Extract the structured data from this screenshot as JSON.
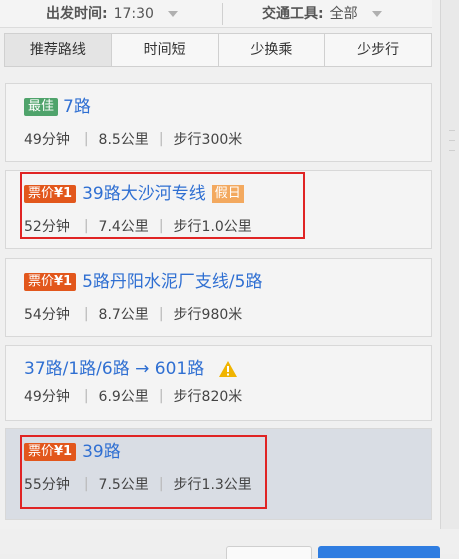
{
  "filters": {
    "departure_label": "出发时间:",
    "departure_value": "17:30",
    "transport_label": "交通工具:",
    "transport_value": "全部"
  },
  "tabs": [
    {
      "label": "推荐路线",
      "active": true
    },
    {
      "label": "时间短",
      "active": false
    },
    {
      "label": "少换乘",
      "active": false
    },
    {
      "label": "少步行",
      "active": false
    }
  ],
  "routes": [
    {
      "badge": "最佳",
      "name": "7路",
      "time": "49分钟",
      "distance": "8.5公里",
      "walk": "步行300米"
    },
    {
      "price_label": "票价",
      "price_value": "¥1",
      "name": "39路大沙河专线",
      "tag": "假日",
      "time": "52分钟",
      "distance": "7.4公里",
      "walk": "步行1.0公里"
    },
    {
      "price_label": "票价",
      "price_value": "¥1",
      "name": "5路丹阳水泥厂支线/5路",
      "time": "54分钟",
      "distance": "8.7公里",
      "walk": "步行980米"
    },
    {
      "name": "37路/1路/6路 → 601路",
      "warning_icon": "warning-icon",
      "time": "49分钟",
      "distance": "6.9公里",
      "walk": "步行820米"
    },
    {
      "price_label": "票价",
      "price_value": "¥1",
      "name": "39路",
      "time": "55分钟",
      "distance": "7.5公里",
      "walk": "步行1.3公里"
    }
  ],
  "colors": {
    "route_link": "#2f6fd2",
    "price_badge": "#e2571c",
    "best_badge": "#4fa36b",
    "holiday_badge": "#f3a95f",
    "highlight_box": "#e02424"
  }
}
